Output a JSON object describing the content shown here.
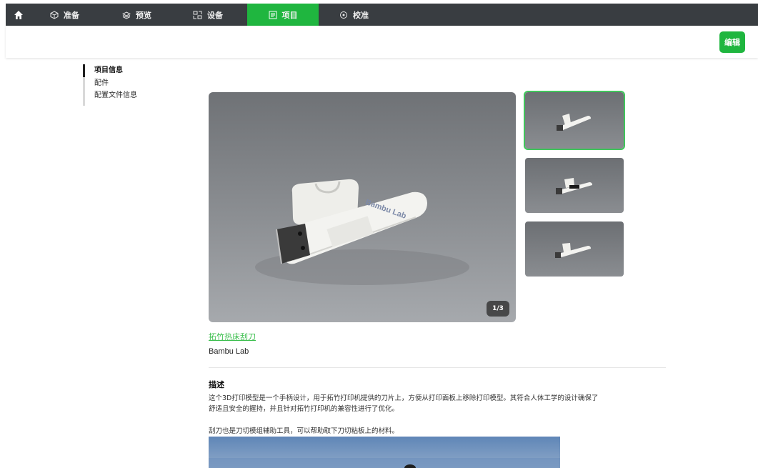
{
  "topbar": {
    "tabs": [
      {
        "label": "准备",
        "icon": "cube-icon"
      },
      {
        "label": "预览",
        "icon": "layers-icon"
      },
      {
        "label": "设备",
        "icon": "device-icon"
      },
      {
        "label": "项目",
        "icon": "project-icon",
        "active": true
      },
      {
        "label": "校准",
        "icon": "calibrate-icon"
      }
    ],
    "active_color": "#1fb63f",
    "bg_color": "#393d41"
  },
  "toolbar": {
    "edit_label": "编辑"
  },
  "sidenav": {
    "items": [
      {
        "label": "项目信息",
        "active": true
      },
      {
        "label": "配件"
      },
      {
        "label": "配置文件信息"
      }
    ]
  },
  "gallery": {
    "counter": "1/3",
    "product_print": "Bambu Lab",
    "thumbnails": 3,
    "selected_index": 0
  },
  "project": {
    "title": "拓竹热床刮刀",
    "author": "Bambu Lab"
  },
  "description": {
    "heading": "描述",
    "paragraph_1_line_1": "这个3D打印模型是一个手柄设计，用于拓竹打印机提供的刀片上，方便从打印面板上移除打印模型。其符合人体工学的设计确保了",
    "paragraph_1_line_2": "舒适且安全的握持，并且针对拓竹打印机的兼容性进行了优化。",
    "paragraph_2": "刮刀也是刀切模组辅助工具，可以帮助取下刀切粘板上的材料。"
  }
}
